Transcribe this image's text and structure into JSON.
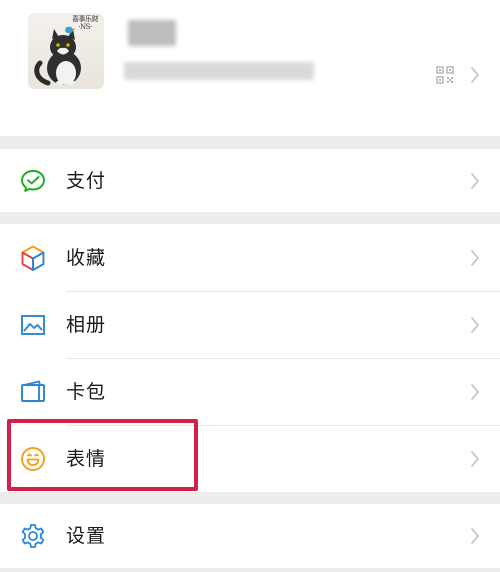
{
  "profile": {
    "avatar_caption": "喜事乐财 ·NS·",
    "name": "",
    "wechat_id": ""
  },
  "menu": {
    "pay": {
      "label": "支付",
      "icon": "wechat-pay-icon",
      "color": "#1aad19"
    },
    "favorites": {
      "label": "收藏",
      "icon": "cube-icon"
    },
    "album": {
      "label": "相册",
      "icon": "picture-icon",
      "color": "#2a87d6"
    },
    "cards": {
      "label": "卡包",
      "icon": "wallet-icon",
      "color": "#2a87d6"
    },
    "stickers": {
      "label": "表情",
      "icon": "smiley-icon",
      "color": "#f3a014"
    },
    "settings": {
      "label": "设置",
      "icon": "gear-icon",
      "color": "#2a87d6"
    }
  },
  "highlight_color": "#d22049"
}
